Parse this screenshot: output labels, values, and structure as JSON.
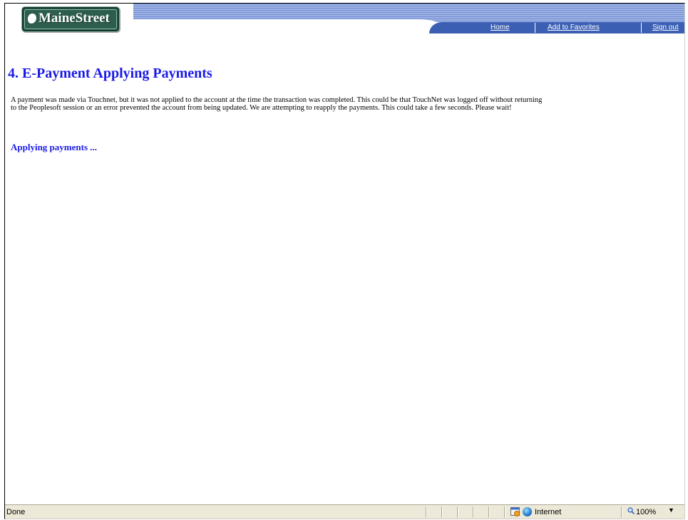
{
  "header": {
    "logo_text": "MaineStreet",
    "nav": [
      {
        "label": "Home"
      },
      {
        "label": "Add to Favorites"
      },
      {
        "label": "Sign out"
      }
    ]
  },
  "main": {
    "title": "4. E-Payment Applying Payments",
    "message": "A payment was made via Touchnet, but it was not applied to the account at the time the transaction was completed. This could be that TouchNet was logged off without returning to the Peoplesoft session or an error prevented the account from being updated. We are attempting to reapply the payments. This could take a few seconds. Please wait!",
    "status_line": "Applying payments ..."
  },
  "statusbar": {
    "status": "Done",
    "zone": "Internet",
    "zoom": "100%"
  },
  "colors": {
    "heading": "#1a1ae6",
    "nav_bar": "#3a5fb3",
    "logo_bg": "#2c5d4d"
  }
}
